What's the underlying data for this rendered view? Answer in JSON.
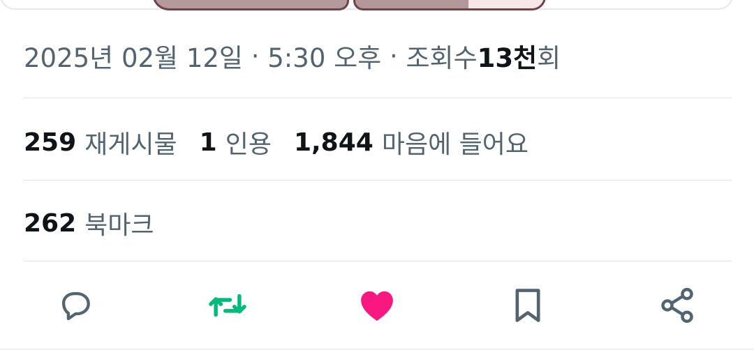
{
  "tweet_meta": {
    "date": "2025년 02월 12일",
    "separator": "·",
    "time": "5:30 오후",
    "views_prefix": "조회수 ",
    "views_count": "13천",
    "views_suffix": "회"
  },
  "engagement": {
    "retweets_count": "259",
    "retweets_label": "재게시물",
    "quotes_count": "1",
    "quotes_label": "인용",
    "likes_count": "1,844",
    "likes_label": "마음에 들어요"
  },
  "bookmarks": {
    "count": "262",
    "label": "북마크"
  },
  "actions": {
    "reply_icon": "reply-icon",
    "retweet_icon": "retweet-icon",
    "like_icon": "heart-icon",
    "bookmark_icon": "bookmark-icon",
    "share_icon": "share-icon"
  },
  "colors": {
    "text_primary": "#0f1419",
    "text_secondary": "#536471",
    "retweet_active": "#00ba7c",
    "like_active": "#f91880",
    "icon_default": "#536471"
  }
}
